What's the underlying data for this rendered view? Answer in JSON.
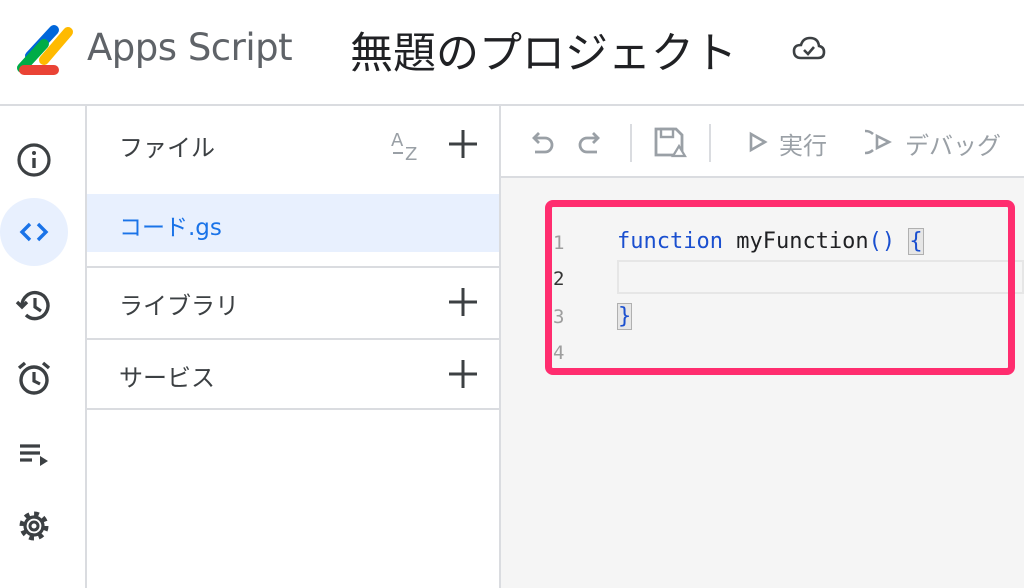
{
  "header": {
    "app_name": "Apps Script",
    "project_title": "無題のプロジェクト",
    "logo_colors": [
      "#0066da",
      "#00ac47",
      "#ffba00",
      "#ea4335"
    ]
  },
  "rail": {
    "items": [
      {
        "icon": "info-icon"
      },
      {
        "icon": "code-icon",
        "active": true
      },
      {
        "icon": "history-icon"
      },
      {
        "icon": "alarm-icon"
      },
      {
        "icon": "executions-icon"
      },
      {
        "icon": "gear-icon"
      }
    ]
  },
  "files_panel": {
    "files_label": "ファイル",
    "sort_icon": "az-sort-icon",
    "file_name": "コード.gs",
    "libraries_label": "ライブラリ",
    "services_label": "サービス"
  },
  "toolbar": {
    "run_label": "実行",
    "debug_label": "デバッグ"
  },
  "editor": {
    "line_numbers": [
      "1",
      "2",
      "3",
      "4"
    ],
    "current_line": "2",
    "code": {
      "keyword": "function",
      "name": "myFunction",
      "parens": "()",
      "open_brace": "{",
      "close_brace": "}"
    }
  },
  "colors": {
    "accent": "#1a73e8",
    "highlight_border": "#ff2d6f",
    "keyword": "#1a4fcf"
  }
}
